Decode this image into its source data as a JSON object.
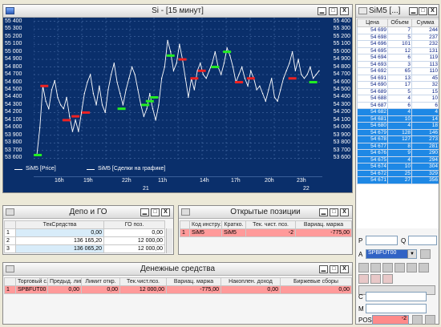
{
  "chart_window": {
    "title": "Si - [15 минут]"
  },
  "chart_data": {
    "type": "line",
    "title": "Si - [15 минут]",
    "ylim": [
      53550,
      55450
    ],
    "y_ticks": [
      53600,
      53700,
      53800,
      53900,
      54000,
      54100,
      54200,
      54300,
      54400,
      54500,
      54600,
      54700,
      54800,
      54900,
      55000,
      55100,
      55200,
      55300,
      55400
    ],
    "y_labels": [
      "53 600",
      "53 700",
      "53 800",
      "53 900",
      "54 000",
      "54 100",
      "54 200",
      "54 300",
      "54 400",
      "54 500",
      "54 600",
      "54 700",
      "54 800",
      "54 900",
      "55 000",
      "55 100",
      "55 200",
      "55 300",
      "55 400"
    ],
    "x_ticks": [
      "16h",
      "19h",
      "22h",
      "11h",
      "14h",
      "17h",
      "20h",
      "23h"
    ],
    "x_dates": [
      "21",
      "22"
    ],
    "series": [
      {
        "name": "SiM5 [Price]",
        "color": "#ffffff",
        "values": [
          53640,
          54000,
          54550,
          54350,
          54250,
          54500,
          54620,
          54400,
          54300,
          54250,
          54400,
          54150,
          53950,
          54100,
          53950,
          54200,
          54450,
          54600,
          54700,
          54450,
          54300,
          54550,
          54300,
          54200,
          54500,
          54700,
          54850,
          54600,
          54450,
          54300,
          54500,
          54650,
          54800,
          54700,
          54500,
          54300,
          54150,
          54250,
          54450,
          54250,
          54100,
          54300,
          54650,
          54800,
          55150,
          55000,
          54750,
          54850,
          55100,
          54900,
          54650,
          54400,
          54650,
          54500,
          54750,
          54850,
          54700,
          54650,
          54750,
          54850,
          55000,
          54800,
          54700,
          54850,
          55050,
          54950,
          54800,
          54600,
          54700,
          54800,
          54650,
          54550,
          54750,
          54650,
          54500,
          54550,
          54450,
          54350,
          54500,
          54650,
          54400,
          54350,
          54500,
          54650,
          54750,
          54850,
          55000,
          54750,
          54900,
          54700,
          54650,
          54700,
          54800,
          54650,
          54700,
          54750
        ]
      }
    ],
    "trades": [
      {
        "side": "buy",
        "x": 0.3,
        "price": 53640
      },
      {
        "side": "sell",
        "x": 2.5,
        "price": 54550
      },
      {
        "side": "sell",
        "x": 10,
        "price": 54100
      },
      {
        "side": "sell",
        "x": 13,
        "price": 54150
      },
      {
        "side": "sell",
        "x": 16.5,
        "price": 54200
      },
      {
        "side": "buy",
        "x": 28.5,
        "price": 54250
      },
      {
        "side": "buy",
        "x": 36.5,
        "price": 54300
      },
      {
        "side": "buy",
        "x": 38,
        "price": 54350
      },
      {
        "side": "buy",
        "x": 39.5,
        "price": 54400
      },
      {
        "side": "buy",
        "x": 45,
        "price": 54950
      },
      {
        "side": "sell",
        "x": 49,
        "price": 54900
      },
      {
        "side": "sell",
        "x": 53,
        "price": 54650
      },
      {
        "side": "sell",
        "x": 55.5,
        "price": 54750
      },
      {
        "side": "buy",
        "x": 60,
        "price": 54800
      },
      {
        "side": "buy",
        "x": 64,
        "price": 55000
      },
      {
        "side": "sell",
        "x": 68,
        "price": 54600
      },
      {
        "side": "sell",
        "x": 72,
        "price": 54650
      },
      {
        "side": "sell",
        "x": 86,
        "price": 54650
      },
      {
        "side": "buy",
        "x": 93,
        "price": 54600
      }
    ],
    "legend": [
      "SiM5 [Price]",
      "SiM5 [Сделки на графике]"
    ],
    "legend_placement": "bottom"
  },
  "depo": {
    "title": "Депо и ГО",
    "columns": [
      "",
      "ТекСредства",
      "ГО поз."
    ],
    "rows": [
      [
        "1",
        "0,00",
        "0,00"
      ],
      [
        "2",
        "136 165,20",
        "12 000,00"
      ],
      [
        "3",
        "136 065,20",
        "12 000,00"
      ]
    ]
  },
  "positions": {
    "title": "Открытые позиции",
    "columns": [
      "",
      "Код инстру.",
      "Кратко.",
      "Тек. чист. поз.",
      "Вариац. маржа"
    ],
    "rows": [
      [
        "1",
        "SiM5",
        "SiM5",
        "-2",
        "-775,00"
      ]
    ]
  },
  "money": {
    "title": "Денежные средства",
    "columns": [
      "",
      "Торговый с.",
      "Предыд. лими",
      "Лимит откр.",
      "Тек.чист.поз.",
      "Вариац. маржа",
      "Накоплен. доход",
      "Биржевые сборы"
    ],
    "rows": [
      [
        "1",
        "SPBFUT00",
        "0,00",
        "0,00",
        "12 000,00",
        "-775,00",
        "0,00",
        "0,00"
      ]
    ]
  },
  "orderbook": {
    "title": "SiM5 [...]",
    "columns": [
      "Цена",
      "Объем",
      "Сумма"
    ],
    "asks": [
      [
        "54 699",
        "7",
        "244"
      ],
      [
        "54 698",
        "5",
        "237"
      ],
      [
        "54 696",
        "101",
        "232"
      ],
      [
        "54 695",
        "12",
        "131"
      ],
      [
        "54 694",
        "6",
        "119"
      ],
      [
        "54 693",
        "3",
        "113"
      ],
      [
        "54 692",
        "65",
        "110"
      ],
      [
        "54 691",
        "13",
        "45"
      ],
      [
        "54 690",
        "17",
        "32"
      ],
      [
        "54 689",
        "5",
        "15"
      ],
      [
        "54 688",
        "4",
        "10"
      ],
      [
        "54 687",
        "6",
        "6"
      ]
    ],
    "bids": [
      [
        "54 682",
        "4",
        "4"
      ],
      [
        "54 681",
        "10",
        "14"
      ],
      [
        "54 680",
        "4",
        "18"
      ],
      [
        "54 679",
        "128",
        "146"
      ],
      [
        "54 678",
        "127",
        "273"
      ],
      [
        "54 677",
        "8",
        "281"
      ],
      [
        "54 676",
        "9",
        "290"
      ],
      [
        "54 675",
        "4",
        "294"
      ],
      [
        "54 674",
        "10",
        "304"
      ],
      [
        "54 672",
        "25",
        "329"
      ],
      [
        "54 671",
        "27",
        "356"
      ]
    ]
  },
  "order_form": {
    "p_label": "P",
    "q_label": "Q",
    "a_label": "A",
    "account": "SPBFUT00",
    "c_label": "C",
    "m_label": "M",
    "pos_label": "POS.",
    "pos_value": "-2"
  },
  "buttons": {
    "min": "▁",
    "max": "□",
    "close": "X"
  }
}
